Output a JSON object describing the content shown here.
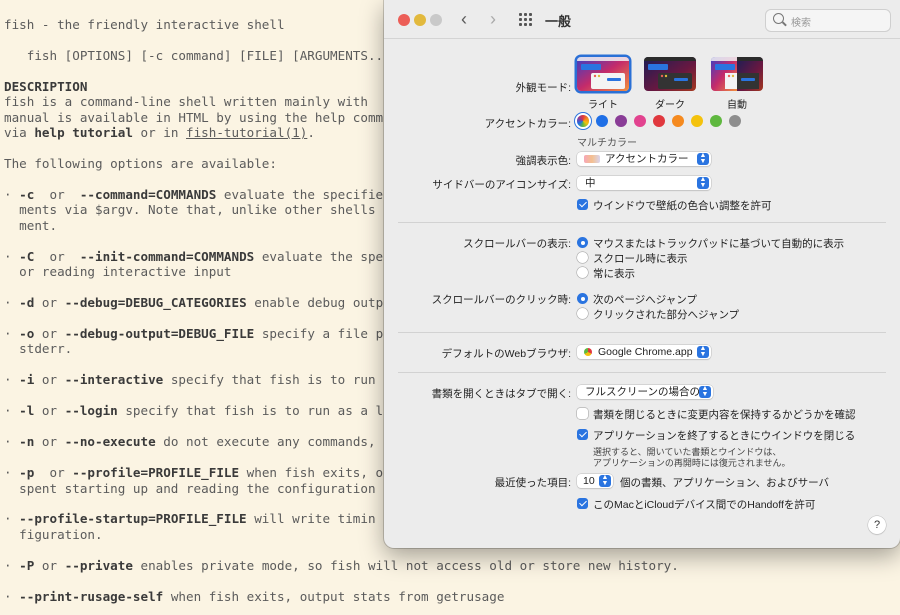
{
  "terminal": {
    "lines": [
      {
        "t": "fish - the friendly interactive shell"
      },
      {
        "t": ""
      },
      {
        "t": "   fish [OPTIONS] [-c command] [FILE] [ARGUMENTS..."
      },
      {
        "t": ""
      },
      {
        "b": "DESCRIPTION"
      },
      {
        "t": "fish is a command-line shell written mainly with "
      },
      {
        "t": "manual is available in HTML by using the help comm"
      },
      {
        "pre": "via ",
        "b": "help tutorial",
        "mid": " or in ",
        "u": "fish-tutorial(1)",
        "post": "."
      },
      {
        "t": ""
      },
      {
        "t": "The following options are available:"
      },
      {
        "t": ""
      },
      {
        "pre": "· ",
        "b": "-c",
        "mid": "  or  ",
        "b2": "--command=COMMANDS",
        "post": " evaluate the specifie"
      },
      {
        "t": "  ments via $argv. Note that, unlike other shells"
      },
      {
        "t": "  ment."
      },
      {
        "t": ""
      },
      {
        "pre": "· ",
        "b": "-C",
        "mid": "  or  ",
        "b2": "--init-command=COMMANDS",
        "post": " evaluate the spe"
      },
      {
        "t": "  or reading interactive input"
      },
      {
        "t": ""
      },
      {
        "pre": "· ",
        "b": "-d",
        "mid": " or ",
        "b2": "--debug=DEBUG_CATEGORIES",
        "post": " enable debug outp"
      },
      {
        "t": ""
      },
      {
        "pre": "· ",
        "b": "-o",
        "mid": " or ",
        "b2": "--debug-output=DEBUG_FILE",
        "post": " specify a file p"
      },
      {
        "t": "  stderr."
      },
      {
        "t": ""
      },
      {
        "pre": "· ",
        "b": "-i",
        "mid": " or ",
        "b2": "--interactive",
        "post": " specify that fish is to run"
      },
      {
        "t": ""
      },
      {
        "pre": "· ",
        "b": "-l",
        "mid": " or ",
        "b2": "--login",
        "post": " specify that fish is to run as a l"
      },
      {
        "t": ""
      },
      {
        "pre": "· ",
        "b": "-n",
        "mid": " or ",
        "b2": "--no-execute",
        "post": " do not execute any commands,"
      },
      {
        "t": ""
      },
      {
        "pre": "· ",
        "b": "-p",
        "mid": "  or ",
        "b2": "--profile=PROFILE_FILE",
        "post": " when fish exits, o"
      },
      {
        "t": "  spent starting up and reading the configuration"
      },
      {
        "t": ""
      },
      {
        "pre": "· ",
        "b": "--profile-startup=PROFILE_FILE",
        "post": " will write timin"
      },
      {
        "t": "  figuration."
      },
      {
        "t": ""
      },
      {
        "pre": "· ",
        "b": "-P",
        "mid": " or ",
        "b2": "--private",
        "post": " enables private mode, so fish will not access old or store new history."
      },
      {
        "t": ""
      },
      {
        "pre": "· ",
        "b": "--print-rusage-self",
        "post": " when fish exits, output stats from getrusage"
      }
    ]
  },
  "window": {
    "title": "一般",
    "search_placeholder": "検索",
    "appearance": {
      "label": "外観モード:",
      "options": [
        {
          "label": "ライト",
          "selected": true
        },
        {
          "label": "ダーク",
          "selected": false
        },
        {
          "label": "自動",
          "selected": false
        }
      ]
    },
    "accent": {
      "label": "アクセントカラー:",
      "caption": "マルチカラー",
      "colors": [
        "multicolor",
        "#1f6fe6",
        "#8a3d97",
        "#e2438f",
        "#e0383e",
        "#f58a1f",
        "#f4c20d",
        "#5fb83f",
        "#8e8e8e"
      ]
    },
    "highlight": {
      "label": "強調表示色:",
      "value": "アクセントカラー"
    },
    "sidebar_icon": {
      "label": "サイドバーのアイコンサイズ:",
      "value": "中"
    },
    "wallpaper_tint": {
      "label": "ウインドウで壁紙の色合い調整を許可",
      "checked": true
    },
    "scrollbars": {
      "label": "スクロールバーの表示:",
      "options": [
        {
          "label": "マウスまたはトラックパッドに基づいて自動的に表示",
          "selected": true
        },
        {
          "label": "スクロール時に表示",
          "selected": false
        },
        {
          "label": "常に表示",
          "selected": false
        }
      ]
    },
    "scroll_click": {
      "label": "スクロールバーのクリック時:",
      "options": [
        {
          "label": "次のページへジャンプ",
          "selected": true
        },
        {
          "label": "クリックされた部分へジャンプ",
          "selected": false
        }
      ]
    },
    "browser": {
      "label": "デフォルトのWebブラウザ:",
      "value": "Google Chrome.app"
    },
    "tabs": {
      "label": "書類を開くときはタブで開く:",
      "value": "フルスクリーンの場合のみ"
    },
    "ask_keep_changes": {
      "label": "書類を閉じるときに変更内容を保持するかどうかを確認",
      "checked": false
    },
    "close_windows": {
      "label": "アプリケーションを終了するときにウインドウを閉じる",
      "checked": true
    },
    "close_windows_note": [
      "選択すると、開いていた書類とウインドウは、",
      "アプリケーションの再開時には復元されません。"
    ],
    "recent": {
      "label": "最近使った項目:",
      "value": "10",
      "suffix": "個の書類、アプリケーション、およびサーバ"
    },
    "handoff": {
      "label": "このMacとiCloudデバイス間でのHandoffを許可",
      "checked": true
    },
    "help": "?",
    "colors": {
      "accent": "#2a74e0",
      "close": "#ec5e57",
      "minimize": "#e2b93d",
      "zoom": "#c9c9c9"
    }
  }
}
